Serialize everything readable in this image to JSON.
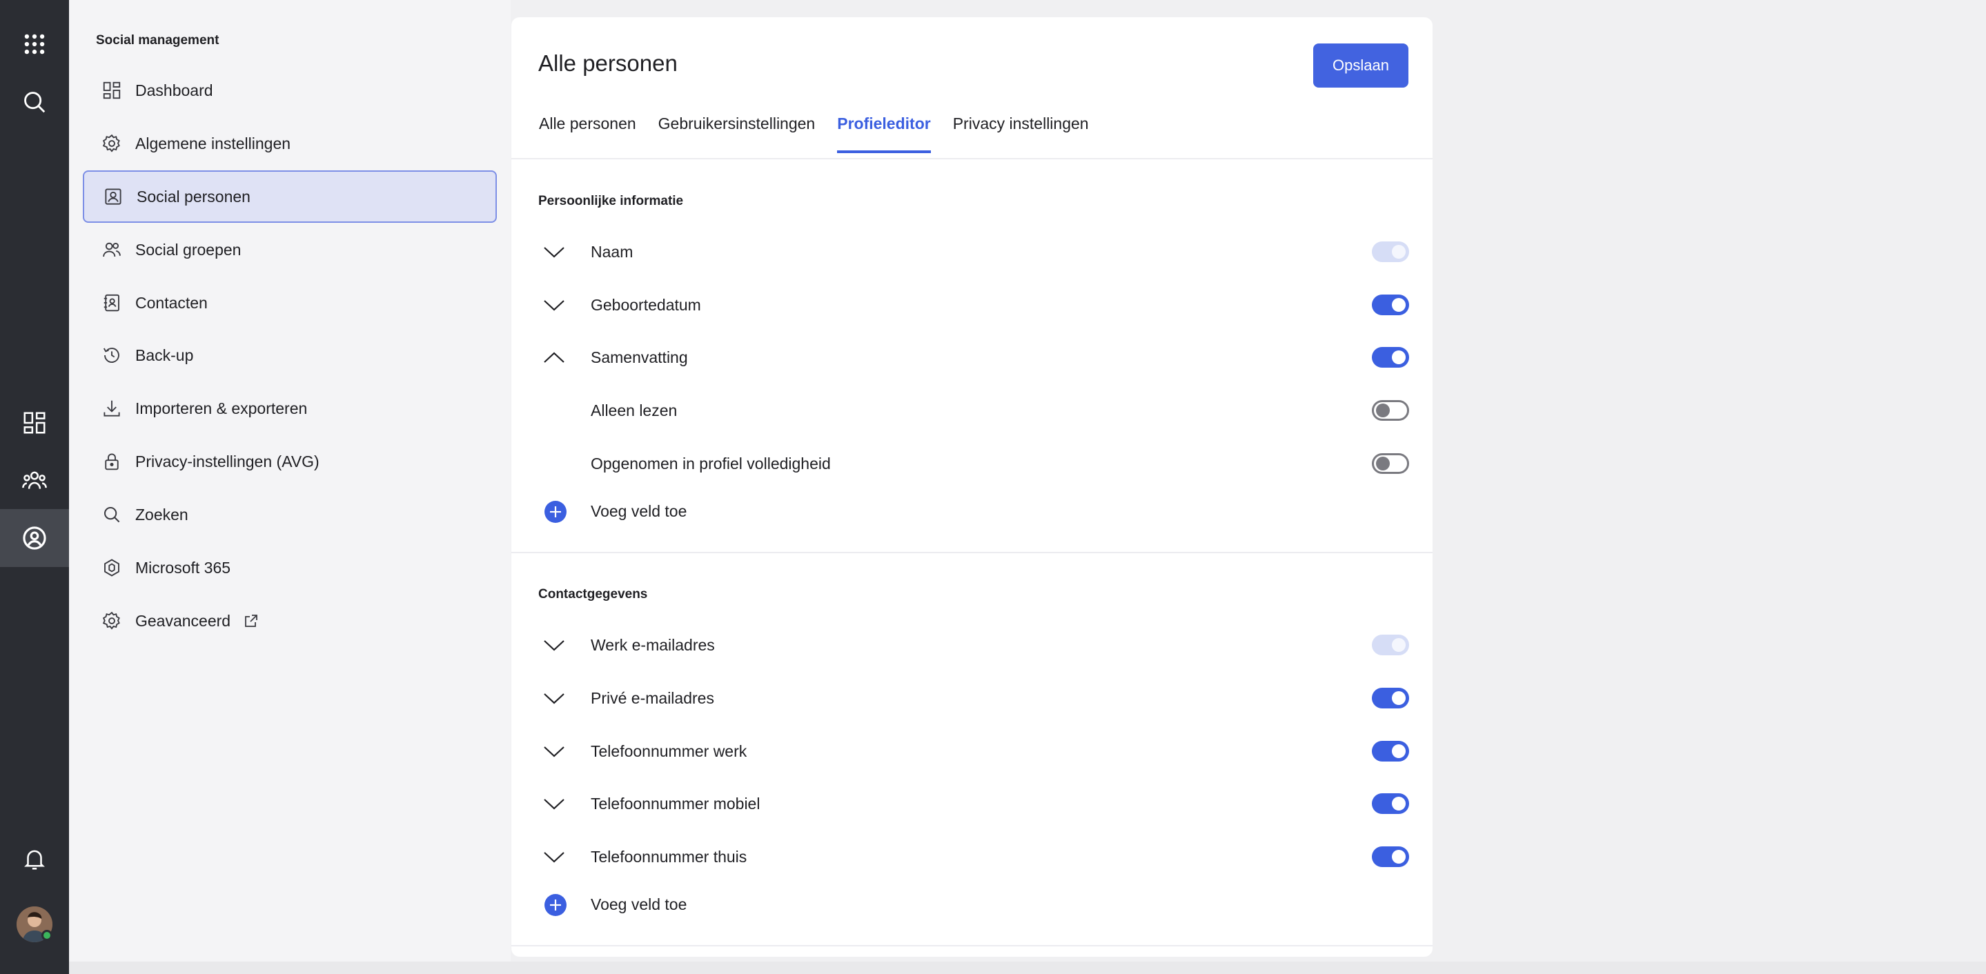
{
  "sidebar": {
    "title": "Social management",
    "items": [
      {
        "label": "Dashboard",
        "icon": "dashboard-icon"
      },
      {
        "label": "Algemene instellingen",
        "icon": "gear-icon"
      },
      {
        "label": "Social personen",
        "icon": "person-card-icon",
        "active": true
      },
      {
        "label": "Social groepen",
        "icon": "group-icon"
      },
      {
        "label": "Contacten",
        "icon": "contact-book-icon"
      },
      {
        "label": "Back-up",
        "icon": "history-icon"
      },
      {
        "label": "Importeren & exporteren",
        "icon": "download-icon"
      },
      {
        "label": "Privacy-instellingen (AVG)",
        "icon": "lock-icon"
      },
      {
        "label": "Zoeken",
        "icon": "search-icon"
      },
      {
        "label": "Microsoft 365",
        "icon": "microsoft-365-icon"
      },
      {
        "label": "Geavanceerd",
        "icon": "gear-icon",
        "external": true
      }
    ]
  },
  "header": {
    "title": "Alle personen",
    "save_label": "Opslaan"
  },
  "tabs": [
    {
      "label": "Alle personen"
    },
    {
      "label": "Gebruikersinstellingen"
    },
    {
      "label": "Profieleditor",
      "active": true
    },
    {
      "label": "Privacy instellingen"
    }
  ],
  "sections": [
    {
      "title": "Persoonlijke informatie",
      "fields": [
        {
          "label": "Naam",
          "expanded": false,
          "toggle": "disabled-on"
        },
        {
          "label": "Geboortedatum",
          "expanded": false,
          "toggle": "on"
        },
        {
          "label": "Samenvatting",
          "expanded": true,
          "toggle": "on"
        },
        {
          "label": "Alleen lezen",
          "sub": true,
          "toggle": "off"
        },
        {
          "label": "Opgenomen in profiel volledigheid",
          "sub": true,
          "toggle": "off"
        }
      ],
      "add_label": "Voeg veld toe"
    },
    {
      "title": "Contactgegevens",
      "fields": [
        {
          "label": "Werk e-mailadres",
          "expanded": false,
          "toggle": "disabled-on"
        },
        {
          "label": "Privé e-mailadres",
          "expanded": false,
          "toggle": "on"
        },
        {
          "label": "Telefoonnummer werk",
          "expanded": false,
          "toggle": "on"
        },
        {
          "label": "Telefoonnummer mobiel",
          "expanded": false,
          "toggle": "on"
        },
        {
          "label": "Telefoonnummer thuis",
          "expanded": false,
          "toggle": "on"
        }
      ],
      "add_label": "Voeg veld toe"
    }
  ],
  "colors": {
    "accent": "#3b5fe0",
    "rail_bg": "#2b2d33",
    "sidebar_active_bg": "#dfe2f5"
  }
}
